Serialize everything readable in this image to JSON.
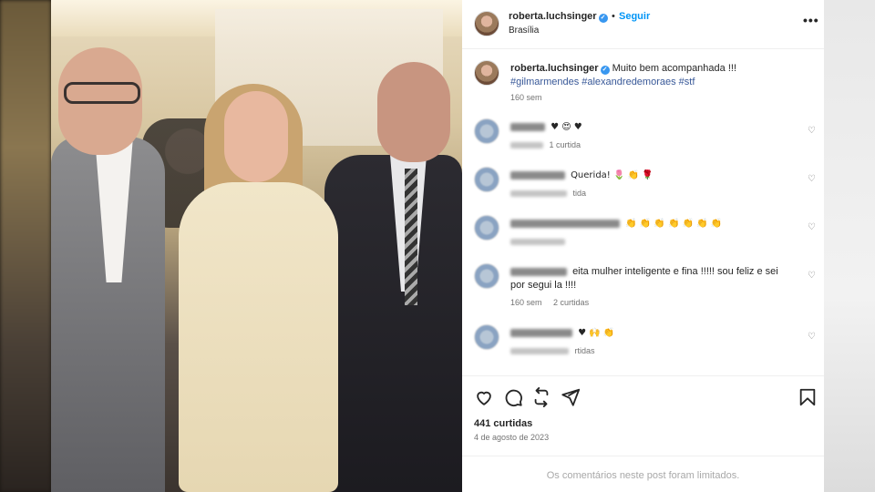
{
  "post": {
    "author": "roberta.luchsinger",
    "follow_label": "Seguir",
    "separator": "•",
    "location": "Brasília",
    "more_label": "•••"
  },
  "caption": {
    "author": "roberta.luchsinger",
    "text": "Muito bem acompanhada !!!",
    "hashtags": "#gilmarmendes #alexandredemoraes #stf",
    "time": "160 sem"
  },
  "comments": [
    {
      "text": "♥ 😍 ♥",
      "meta_likes": "1 curtida"
    },
    {
      "text": "Querida! 🌷 👏 🌹",
      "meta_likes": "tida"
    },
    {
      "text": "👏 👏 👏 👏 👏 👏 👏",
      "meta_likes": ""
    },
    {
      "text": "eita mulher inteligente e fina !!!!! sou feliz e sei por segui la !!!!",
      "meta_time": "160 sem",
      "meta_likes": "2 curtidas"
    },
    {
      "text": "♥ 🙌 👏",
      "meta_likes": "rtidas"
    }
  ],
  "stats": {
    "likes": "441 curtidas",
    "date": "4 de agosto de 2023"
  },
  "footer": {
    "limited": "Os comentários neste post foram limitados."
  },
  "icons": {
    "like": "heart-icon",
    "comment": "comment-icon",
    "share": "repost-icon",
    "send": "send-icon",
    "save": "bookmark-icon"
  },
  "colors": {
    "link": "#0095f6",
    "hashtag": "#385898",
    "verified": "#3897f0"
  }
}
